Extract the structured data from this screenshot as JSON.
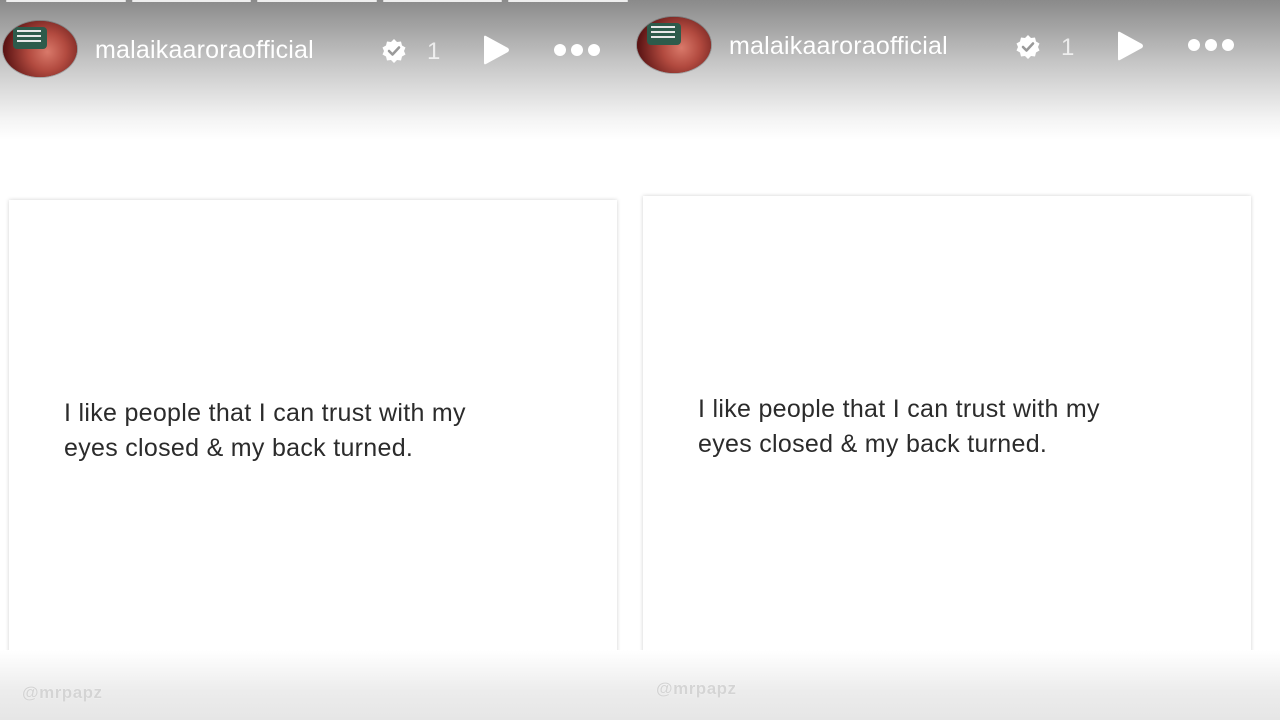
{
  "stories": [
    {
      "username": "malaikaaroraofficial",
      "count": "1",
      "quote_line1": "I like people that I can trust with my",
      "quote_line2": "eyes closed & my back turned.",
      "watermark": "@mrpapz",
      "icons": [
        "avatar",
        "verified-badge-icon",
        "play-icon",
        "more-icon"
      ]
    },
    {
      "username": "malaikaaroraofficial",
      "count": "1",
      "quote_line1": "I like people that I can trust with my",
      "quote_line2": "eyes closed & my back turned.",
      "watermark": "@mrpapz",
      "icons": [
        "avatar",
        "verified-badge-icon",
        "play-icon",
        "more-icon"
      ]
    }
  ],
  "colors": {
    "header_text": "#ffffff",
    "quote_text": "#2b2b2b",
    "card_bg": "#ffffff"
  }
}
